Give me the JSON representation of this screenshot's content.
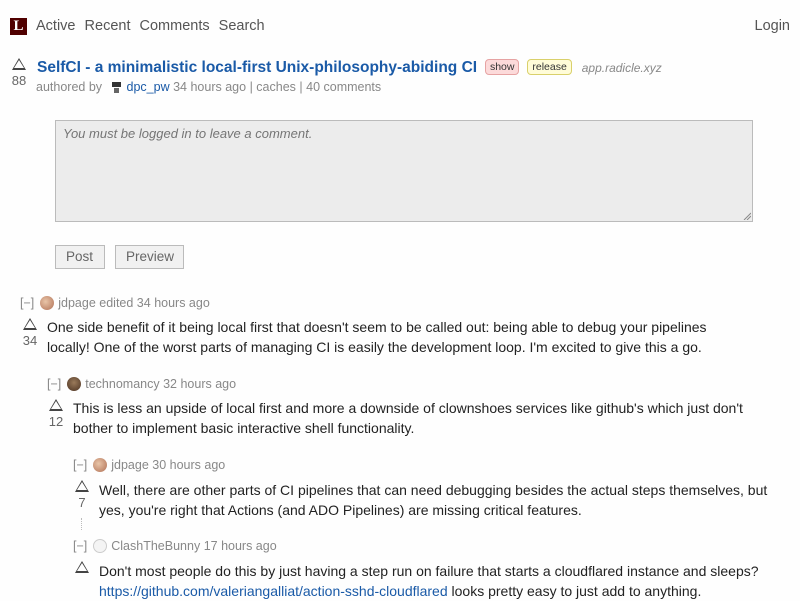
{
  "header": {
    "logo": "L",
    "nav": [
      "Active",
      "Recent",
      "Comments",
      "Search"
    ],
    "login": "Login"
  },
  "story": {
    "score": "88",
    "title": "SelfCI - a minimalistic local-first Unix-philosophy-abiding CI",
    "tags": [
      "show",
      "release"
    ],
    "domain": "app.radicle.xyz",
    "authored_by": "authored by",
    "author": "dpc_pw",
    "time": "34 hours ago",
    "sep1": "|",
    "caches": "caches",
    "sep2": "|",
    "comments": "40 comments"
  },
  "comment_form": {
    "placeholder": "You must be logged in to leave a comment.",
    "post": "Post",
    "preview": "Preview"
  },
  "comments": [
    {
      "toggle": "[−]",
      "user": "jdpage",
      "meta": "edited 34 hours ago",
      "score": "34",
      "body": "One side benefit of it being local first that doesn't seem to be called out: being able to debug your pipelines locally! One of the worst parts of managing CI is easily the development loop. I'm excited to give this a go."
    },
    {
      "toggle": "[−]",
      "user": "technomancy",
      "meta": "32 hours ago",
      "score": "12",
      "body": "This is less an upside of local first and more a downside of clownshoes services like github's which just don't bother to implement basic interactive shell functionality."
    },
    {
      "toggle": "[−]",
      "user": "jdpage",
      "meta": "30 hours ago",
      "score": "7",
      "body": "Well, there are other parts of CI pipelines that can need debugging besides the actual steps themselves, but yes, you're right that Actions (and ADO Pipelines) are missing critical features."
    },
    {
      "toggle": "[−]",
      "user": "ClashTheBunny",
      "meta": "17 hours ago",
      "score": "",
      "body": "Don't most people do this by just having a step run on failure that starts a cloudflared instance and sleeps?",
      "link": "https://github.com/valeriangalliat/action-sshd-cloudflared",
      "body_after": " looks pretty easy to just add to anything."
    }
  ]
}
